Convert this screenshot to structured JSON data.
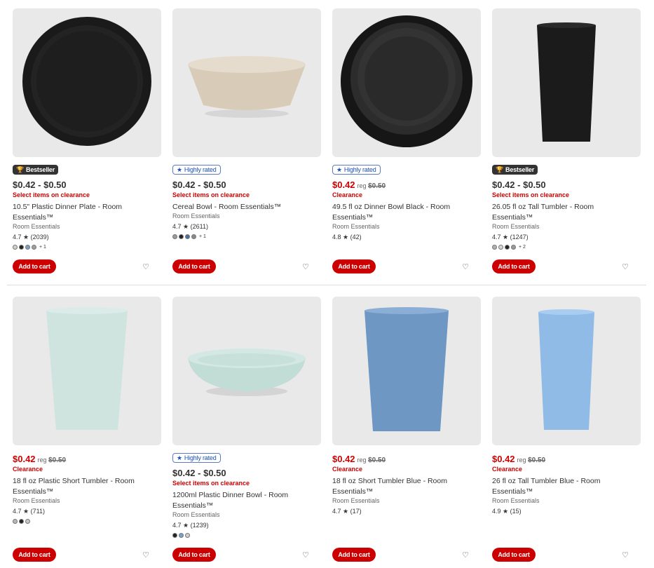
{
  "products": [
    {
      "badge": {
        "type": "best",
        "icon": "trophy-icon",
        "label": "Bestseller"
      },
      "price": "$0.42 - $0.50",
      "price_red": false,
      "reg_label": "",
      "reg_price": "",
      "promo": "Select items on clearance",
      "title": "10.5\" Plastic Dinner Plate - Room Essentials™",
      "brand": "Room Essentials",
      "rating": "4.7",
      "reviews": "(2039)",
      "swatches": [
        "#d8cfc0",
        "#222222",
        "#7aa0c8",
        "#a0a0a0"
      ],
      "more": "+ 1",
      "image": "plate-black",
      "add_label": "Add to cart"
    },
    {
      "badge": {
        "type": "rated",
        "icon": "star-icon",
        "label": "Highly rated"
      },
      "price": "$0.42 - $0.50",
      "price_red": false,
      "reg_label": "",
      "reg_price": "",
      "promo": "Select items on clearance",
      "title": "Cereal Bowl - Room Essentials™",
      "brand": "Room Essentials",
      "rating": "4.7",
      "reviews": "(2611)",
      "swatches": [
        "#9a9a9a",
        "#222222",
        "#4a6fa5",
        "#8a8a8a"
      ],
      "more": "+ 1",
      "image": "bowl-beige",
      "add_label": "Add to cart"
    },
    {
      "badge": {
        "type": "rated",
        "icon": "star-icon",
        "label": "Highly rated"
      },
      "price": "$0.42",
      "price_red": true,
      "reg_label": "reg",
      "reg_price": "$0.50",
      "promo": "Clearance",
      "title": "49.5 fl oz Dinner Bowl Black - Room Essentials™",
      "brand": "Room Essentials",
      "rating": "4.8",
      "reviews": "(42)",
      "swatches": [],
      "more": "",
      "image": "bowl-black",
      "add_label": "Add to cart"
    },
    {
      "badge": {
        "type": "best",
        "icon": "trophy-icon",
        "label": "Bestseller"
      },
      "price": "$0.42 - $0.50",
      "price_red": false,
      "reg_label": "",
      "reg_price": "",
      "promo": "Select items on clearance",
      "title": "26.05 fl oz Tall Tumbler - Room Essentials™",
      "brand": "Room Essentials",
      "rating": "4.7",
      "reviews": "(1247)",
      "swatches": [
        "#b0b0b0",
        "#cfd8d8",
        "#222222",
        "#9a9a9a"
      ],
      "more": "+ 2",
      "image": "tumbler-black",
      "add_label": "Add to cart"
    },
    {
      "badge": null,
      "price": "$0.42",
      "price_red": true,
      "reg_label": "reg",
      "reg_price": "$0.50",
      "promo": "Clearance",
      "title": "18 fl oz Plastic Short Tumbler - Room Essentials™",
      "brand": "Room Essentials",
      "rating": "4.7",
      "reviews": "(711)",
      "swatches": [
        "#b8b8b8",
        "#222222",
        "#c8c8c8"
      ],
      "more": "",
      "image": "tumbler-mint",
      "add_label": "Add to cart"
    },
    {
      "badge": {
        "type": "rated",
        "icon": "star-icon",
        "label": "Highly rated"
      },
      "price": "$0.42 - $0.50",
      "price_red": false,
      "reg_label": "",
      "reg_price": "",
      "promo": "Select items on clearance",
      "title": "1200ml Plastic Dinner Bowl - Room Essentials™",
      "brand": "Room Essentials",
      "rating": "4.7",
      "reviews": "(1239)",
      "swatches": [
        "#222222",
        "#7aa0c8",
        "#d0d0d0"
      ],
      "more": "",
      "image": "bowl-mint",
      "add_label": "Add to cart"
    },
    {
      "badge": null,
      "price": "$0.42",
      "price_red": true,
      "reg_label": "reg",
      "reg_price": "$0.50",
      "promo": "Clearance",
      "title": "18 fl oz Short Tumbler Blue - Room Essentials™",
      "brand": "Room Essentials",
      "rating": "4.7",
      "reviews": "(17)",
      "swatches": [],
      "more": "",
      "image": "tumbler-blue-short",
      "add_label": "Add to cart"
    },
    {
      "badge": null,
      "price": "$0.42",
      "price_red": true,
      "reg_label": "reg",
      "reg_price": "$0.50",
      "promo": "Clearance",
      "title": "26 fl oz Tall Tumbler Blue - Room Essentials™",
      "brand": "Room Essentials",
      "rating": "4.9",
      "reviews": "(15)",
      "swatches": [],
      "more": "",
      "image": "tumbler-blue-tall",
      "add_label": "Add to cart"
    }
  ],
  "colors": {
    "accent": "#cc0000",
    "badge_dark": "#333333",
    "badge_blue": "#1d4fb5"
  }
}
